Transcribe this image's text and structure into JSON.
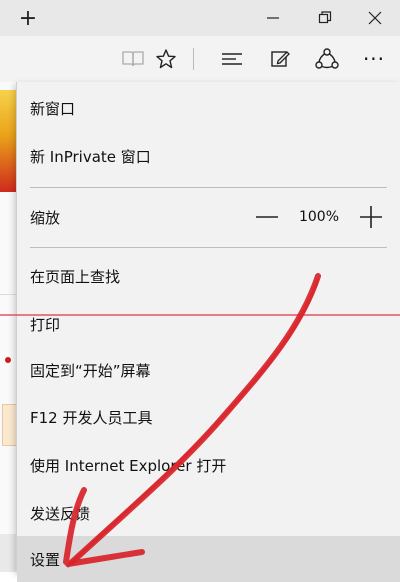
{
  "titlebar": {
    "new_tab_glyph": "+",
    "minimize_glyph": "—",
    "restore_glyph": "❐",
    "close_glyph": "✕"
  },
  "toolbar": {
    "icons": [
      "reading-view-icon",
      "favorite-star-icon",
      "hub-icon",
      "web-note-icon",
      "share-icon",
      "more-icon"
    ],
    "more_glyph": "···"
  },
  "menu": {
    "items": [
      {
        "label": "新窗口"
      },
      {
        "label": "新 InPrivate 窗口"
      },
      {
        "label": "缩放"
      },
      {
        "label": "在页面上查找"
      },
      {
        "label": "打印"
      },
      {
        "label": "固定到“开始”屏幕"
      },
      {
        "label": "F12 开发人员工具"
      },
      {
        "label": "使用 Internet Explorer 打开"
      },
      {
        "label": "发送反馈"
      },
      {
        "label": "设置"
      }
    ],
    "zoom": {
      "decrease_glyph": "—",
      "value": "100%",
      "increase_glyph": "+"
    }
  },
  "colors": {
    "annotation_arrow": "#d8232a",
    "annotation_line": "#e0344a",
    "menu_bg": "#f2f2f2",
    "hover_bg": "#dadada"
  }
}
